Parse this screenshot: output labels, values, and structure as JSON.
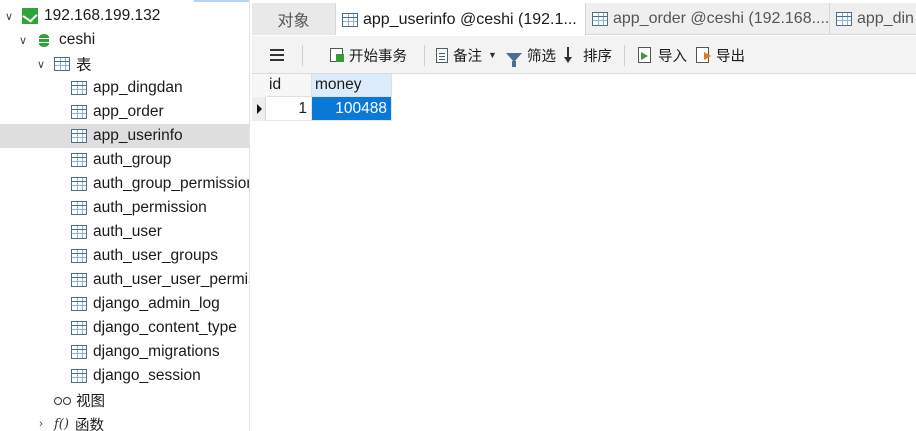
{
  "tree": {
    "connection": "192.168.199.132",
    "database": "ceshi",
    "tables_group": "表",
    "tables": [
      "app_dingdan",
      "app_order",
      "app_userinfo",
      "auth_group",
      "auth_group_permissions",
      "auth_permission",
      "auth_user",
      "auth_user_groups",
      "auth_user_user_permissions",
      "django_admin_log",
      "django_content_type",
      "django_migrations",
      "django_session"
    ],
    "selected_table": "app_userinfo",
    "views_label": "视图",
    "functions_icon_text": "f()",
    "functions_label": "函数"
  },
  "tabs": {
    "objects": "对象",
    "items": [
      {
        "label": "app_userinfo @ceshi (192.1...",
        "active": true
      },
      {
        "label": "app_order @ceshi (192.168....",
        "active": false
      },
      {
        "label": "app_din",
        "active": false
      }
    ]
  },
  "toolbar": {
    "begin_transaction": "开始事务",
    "note": "备注",
    "filter": "筛选",
    "sort": "排序",
    "import": "导入",
    "export": "导出"
  },
  "grid": {
    "columns": [
      "id",
      "money"
    ],
    "rows": [
      [
        "1",
        "100488"
      ]
    ]
  },
  "colors": {
    "selection": "#0a78d7",
    "header_selected": "#dcecfb",
    "tree_selected": "#dedede",
    "db_green": "#2fa33a"
  }
}
